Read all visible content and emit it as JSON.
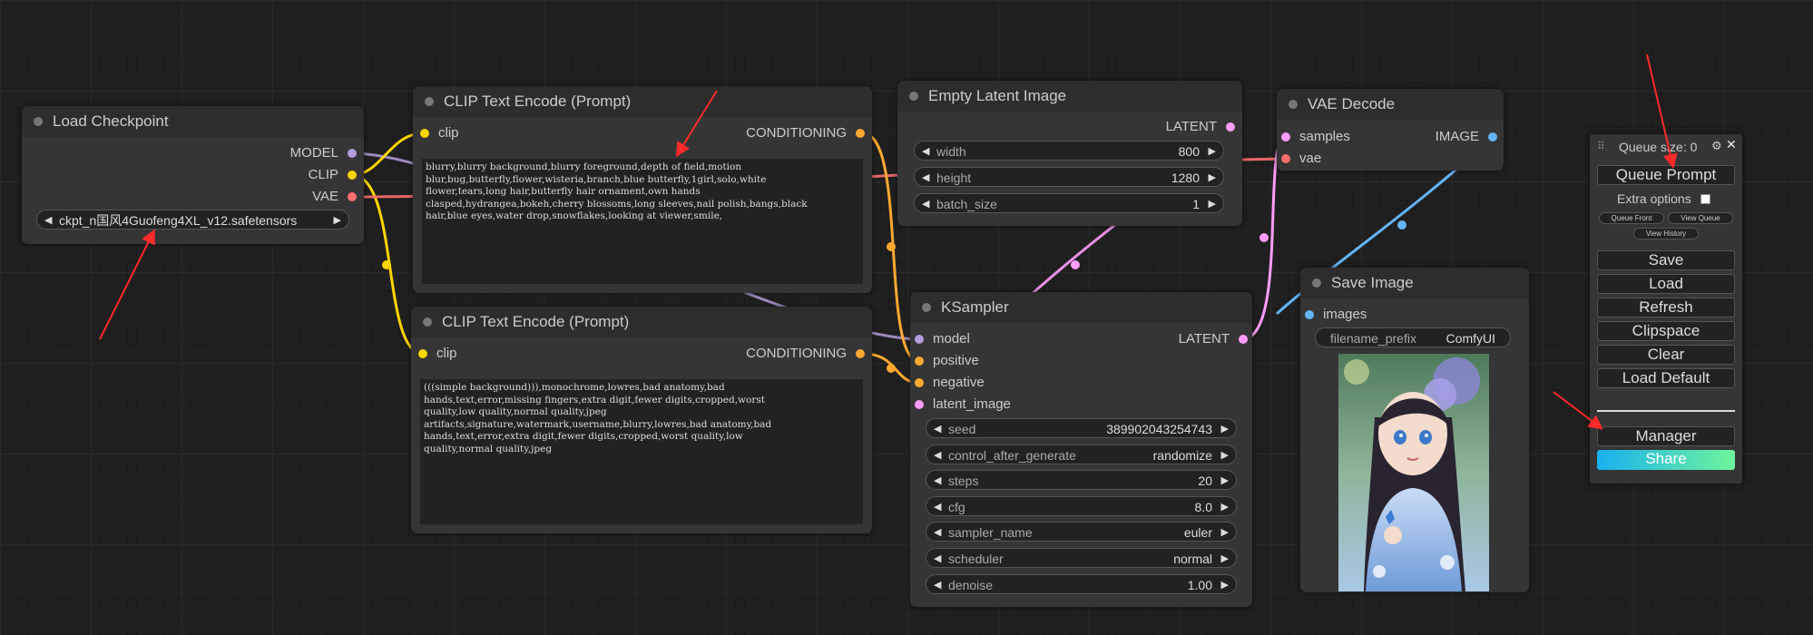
{
  "colors": {
    "model": "#b39ddb",
    "clip": "#ffd500",
    "vae": "#ff6e6e",
    "conditioning": "#ffa931",
    "latent": "#ff9cf9",
    "image": "#64b5f6",
    "accent_arrow": "#ff2a2a",
    "share_gradient": [
      "#18b0f0",
      "#6ef59a"
    ]
  },
  "nodes": {
    "load_checkpoint": {
      "title": "Load Checkpoint",
      "outputs": [
        "MODEL",
        "CLIP",
        "VAE"
      ],
      "ckpt_name": "ckpt_n国风4Guofeng4XL_v12.safetensors"
    },
    "clip_pos": {
      "title": "CLIP Text Encode (Prompt)",
      "input": "clip",
      "output": "CONDITIONING",
      "text": "blurry,blurry background,blurry foreground,depth of field,motion\nblur,bug,butterfly,flower,wisteria,branch,blue butterfly,1girl,solo,white\nflower,tears,long hair,butterfly hair ornament,own hands\nclasped,hydrangea,bokeh,cherry blossoms,long sleeves,nail polish,bangs,black\nhair,blue eyes,water drop,snowflakes,looking at viewer,smile,"
    },
    "clip_neg": {
      "title": "CLIP Text Encode (Prompt)",
      "input": "clip",
      "output": "CONDITIONING",
      "text": "(((simple background))),monochrome,lowres,bad anatomy,bad\nhands,text,error,missing fingers,extra digit,fewer digits,cropped,worst\nquality,low quality,normal quality,jpeg\nartifacts,signature,watermark,username,blurry,lowres,bad anatomy,bad\nhands,text,error,extra digit,fewer digits,cropped,worst quality,low\nquality,normal quality,jpeg"
    },
    "empty_latent": {
      "title": "Empty Latent Image",
      "output": "LATENT",
      "widgets": [
        {
          "label": "width",
          "value": "800"
        },
        {
          "label": "height",
          "value": "1280"
        },
        {
          "label": "batch_size",
          "value": "1"
        }
      ]
    },
    "vae_decode": {
      "title": "VAE Decode",
      "inputs": [
        "samples",
        "vae"
      ],
      "output": "IMAGE"
    },
    "ksampler": {
      "title": "KSampler",
      "inputs": [
        "model",
        "positive",
        "negative",
        "latent_image"
      ],
      "output": "LATENT",
      "widgets": [
        {
          "label": "seed",
          "value": "389902043254743"
        },
        {
          "label": "control_after_generate",
          "value": "randomize"
        },
        {
          "label": "steps",
          "value": "20"
        },
        {
          "label": "cfg",
          "value": "8.0"
        },
        {
          "label": "sampler_name",
          "value": "euler"
        },
        {
          "label": "scheduler",
          "value": "normal"
        },
        {
          "label": "denoise",
          "value": "1.00"
        }
      ]
    },
    "save_image": {
      "title": "Save Image",
      "input": "images",
      "prefix_label": "filename_prefix",
      "prefix_value": "ComfyUI"
    }
  },
  "menu": {
    "queue_size": "Queue size: 0",
    "queue_prompt": "Queue Prompt",
    "extra_options": "Extra options",
    "queue_front": "Queue Front",
    "view_queue": "View Queue",
    "view_history": "View History",
    "buttons": [
      "Save",
      "Load",
      "Refresh",
      "Clipspace",
      "Clear",
      "Load Default"
    ],
    "manager": "Manager",
    "share": "Share"
  }
}
